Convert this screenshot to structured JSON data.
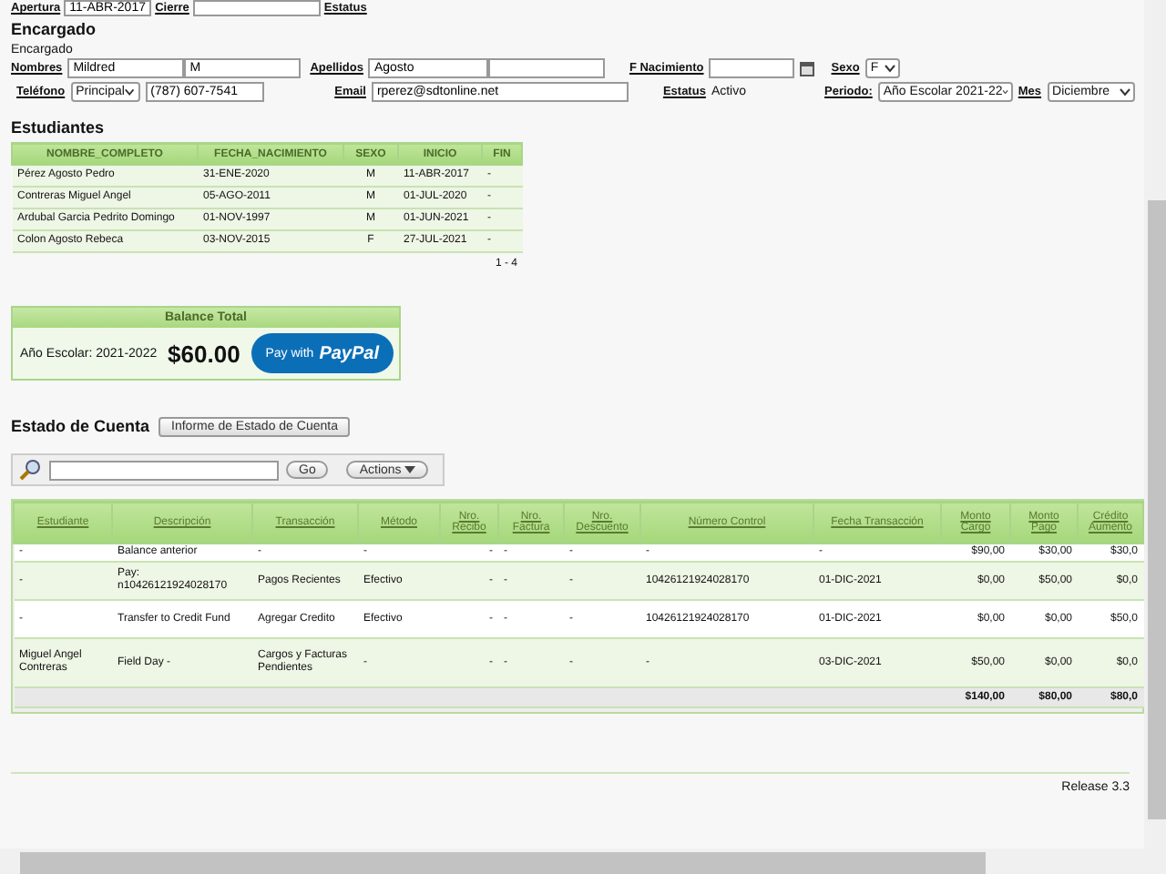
{
  "top_fields": [
    {
      "label": "Apertura",
      "value": "11-ABR-2017"
    },
    {
      "label": "Cierre"
    },
    {
      "label": "Estatus"
    }
  ],
  "encargado": {
    "heading": "Encargado",
    "subheading": "Encargado",
    "nombres": {
      "label": "Nombres",
      "first": "Mildred",
      "middle": "M"
    },
    "apellidos": {
      "label": "Apellidos",
      "first": "Agosto"
    },
    "f_nacimiento": {
      "label": "F Nacimiento"
    },
    "sexo": {
      "label": "Sexo",
      "value": "F"
    },
    "telefono": {
      "label": "Teléfono",
      "type": "Principal",
      "value": "(787) 607-7541"
    },
    "email": {
      "label": "Email",
      "value": "rperez@sdtonline.net"
    },
    "estatus": {
      "label": "Estatus",
      "value": "Activo"
    },
    "periodo": {
      "label": "Periodo:",
      "value": "Año Escolar 2021-22"
    },
    "mes": {
      "label": "Mes",
      "value": "Diciembre"
    }
  },
  "estudiantes": {
    "heading": "Estudiantes",
    "columns": [
      "NOMBRE_COMPLETO",
      "FECHA_NACIMIENTO",
      "SEXO",
      "INICIO",
      "FIN"
    ],
    "rows": [
      [
        "Pérez Agosto Pedro",
        "31-ENE-2020",
        "M",
        "11-ABR-2017",
        "-"
      ],
      [
        "Contreras Miguel Angel",
        "05-AGO-2011",
        "M",
        "01-JUL-2020",
        "-"
      ],
      [
        "Ardubal Garcia Pedrito Domingo",
        "01-NOV-1997",
        "M",
        "01-JUN-2021",
        "-"
      ],
      [
        "Colon Agosto Rebeca",
        "03-NOV-2015",
        "F",
        "27-JUL-2021",
        "-"
      ]
    ],
    "pagination": "1 - 4"
  },
  "balance": {
    "title": "Balance Total",
    "year": "Año Escolar: 2021-2022",
    "amount": "$60.00",
    "pay_prefix": "Pay with",
    "pay_brand": "PayPal"
  },
  "estado_cuenta": {
    "heading": "Estado de Cuenta",
    "report_button": "Informe de Estado de Cuenta",
    "go_button": "Go",
    "actions_button": "Actions",
    "columns": [
      "Estudiante",
      "Descripción",
      "Transacción",
      "Método",
      "Nro. Recibo",
      "Nro. Factura",
      "Nro. Descuento",
      "Número Control",
      "Fecha Transacción",
      "Monto Cargo",
      "Monto Pago",
      "Crédito Aumento"
    ],
    "rows": [
      [
        "-",
        "Balance anterior",
        "-",
        "-",
        "-",
        "-",
        "-",
        "-",
        "-",
        "$90,00",
        "$30,00",
        "$30,0"
      ],
      [
        "-",
        "Pay: n10426121924028170",
        "Pagos Recientes",
        "Efectivo",
        "-",
        "-",
        "-",
        "10426121924028170",
        "01-DIC-2021",
        "$0,00",
        "$50,00",
        "$0,0"
      ],
      [
        "-",
        "Transfer to Credit Fund",
        "Agregar Credito",
        "Efectivo",
        "-",
        "-",
        "-",
        "10426121924028170",
        "01-DIC-2021",
        "$0,00",
        "$0,00",
        "$50,0"
      ],
      [
        "Miguel Angel Contreras",
        "Field Day -",
        "Cargos y Facturas Pendientes",
        "-",
        "-",
        "-",
        "-",
        "-",
        "03-DIC-2021",
        "$50,00",
        "$0,00",
        "$0,0"
      ]
    ],
    "totals": {
      "monto_cargo": "$140,00",
      "monto_pago": "$80,00",
      "credito_aumento": "$80,0"
    }
  },
  "footer": "Release 3.3"
}
